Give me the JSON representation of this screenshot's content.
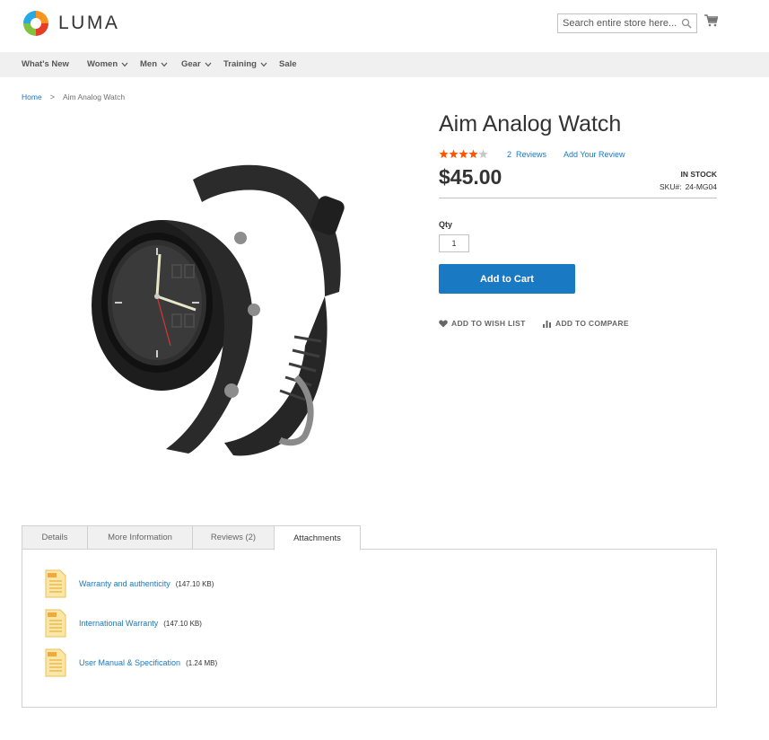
{
  "header": {
    "logo_text": "LUMA",
    "search_placeholder": "Search entire store here..."
  },
  "nav": {
    "items": [
      {
        "label": "What's New",
        "dropdown": false
      },
      {
        "label": "Women",
        "dropdown": true
      },
      {
        "label": "Men",
        "dropdown": true
      },
      {
        "label": "Gear",
        "dropdown": true
      },
      {
        "label": "Training",
        "dropdown": true
      },
      {
        "label": "Sale",
        "dropdown": false
      }
    ]
  },
  "breadcrumb": {
    "home": "Home",
    "separator": ">",
    "current": "Aim Analog Watch"
  },
  "product": {
    "title": "Aim Analog Watch",
    "rating_stars": 4,
    "rating_max": 5,
    "reviews_link": "2  Reviews",
    "add_review": "Add Your Review",
    "price": "$45.00",
    "stock": "IN STOCK",
    "sku_label": "SKU#:",
    "sku": "24-MG04",
    "qty_label": "Qty",
    "qty_value": "1",
    "add_to_cart": "Add to Cart",
    "wishlist": "ADD TO WISH LIST",
    "compare": "ADD TO COMPARE"
  },
  "tabs": {
    "items": [
      {
        "label": "Details"
      },
      {
        "label": "More Information"
      },
      {
        "label": "Reviews (2)"
      },
      {
        "label": "Attachments"
      }
    ],
    "active": "Attachments"
  },
  "attachments": [
    {
      "name": "Warranty and authenticity",
      "size": "(147.10 KB)",
      "icon": "pdf-file-icon"
    },
    {
      "name": "International Warranty",
      "size": "(147.10 KB)",
      "icon": "pdf-file-icon"
    },
    {
      "name": "User Manual & Specification",
      "size": "(1.24 MB)",
      "icon": "pdf-file-icon"
    }
  ],
  "colors": {
    "accent": "#1979c3",
    "star": "#ff5501",
    "nav_bg": "#f0f0f0"
  }
}
